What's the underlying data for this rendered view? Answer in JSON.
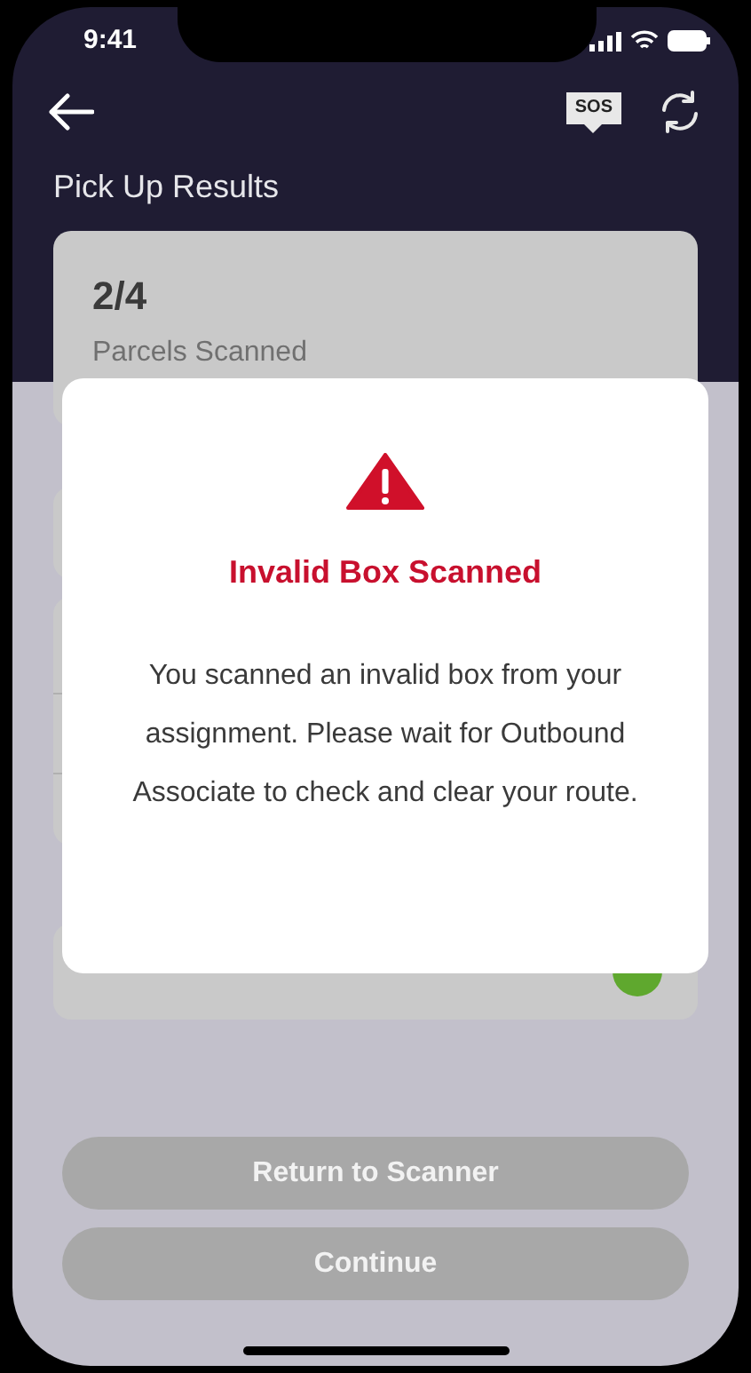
{
  "status_bar": {
    "time": "9:41"
  },
  "header": {
    "title": "Pick Up Results",
    "sos_label": "SOS"
  },
  "summary": {
    "count": "2/4",
    "label": "Parcels Scanned"
  },
  "modal": {
    "title": "Invalid Box Scanned",
    "message": "You scanned an invalid box from your assignment. Please wait for Outbound Associate to check and clear your route."
  },
  "buttons": [
    {
      "label": "Return to Scanner",
      "disabled": true
    },
    {
      "label": "Continue",
      "disabled": true
    }
  ]
}
